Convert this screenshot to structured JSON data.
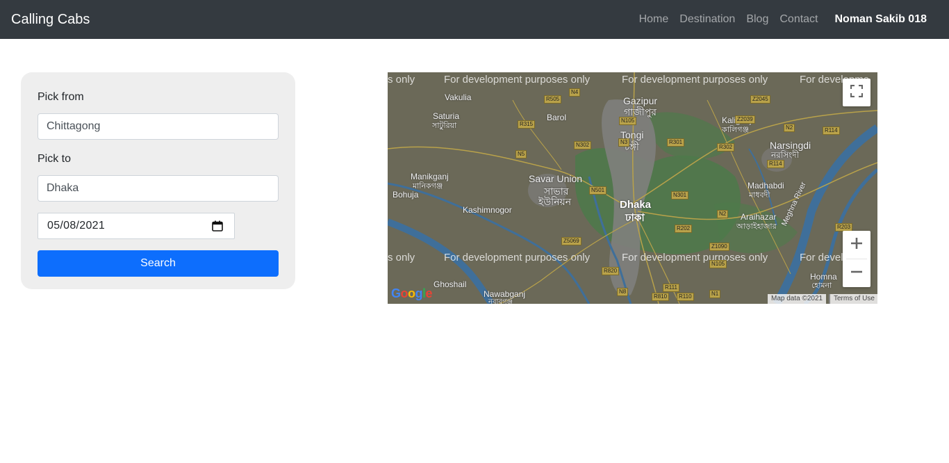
{
  "navbar": {
    "brand": "Calling Cabs",
    "links": [
      "Home",
      "Destination",
      "Blog",
      "Contact"
    ],
    "user": "Noman Sakib 018"
  },
  "form": {
    "pick_from_label": "Pick from",
    "pick_from_value": "Chittagong",
    "pick_to_label": "Pick to",
    "pick_to_value": "Dhaka",
    "date_value": "05/08/2021",
    "search_label": "Search"
  },
  "map": {
    "watermark": "For development purposes only",
    "watermark_partial_left": "s only",
    "watermark_partial_right": "For developme",
    "places": {
      "vakulia": "Vakulia",
      "saturia": "Saturia",
      "saturia_bn": "সাটুরিয়া",
      "barol": "Barol",
      "gazipur": "Gazipur",
      "gazipur_bn": "গাজীপুর",
      "kaliganj": "Kaliganj",
      "kaliganj_bn": "কালিগঞ্জ",
      "narsingdi": "Narsingdi",
      "narsingdi_bn": "নরসিংদী",
      "tongi": "Tongi",
      "tongi_bn": "টঙ্গী",
      "manikganj": "Manikganj",
      "manikganj_bn": "মানিকগঞ্জ",
      "savar": "Savar Union",
      "savar_bn1": "সাভার",
      "savar_bn2": "ইউনিয়ন",
      "bohuja": "Bohuja",
      "kashimnogor": "Kashimnogor",
      "dhaka": "Dhaka",
      "dhaka_bn": "ঢাকা",
      "madhabdi": "Madhabdi",
      "madhabdi_bn": "মাধবদী",
      "araihazar": "Araihazar",
      "araihazar_bn": "আড়াইহাজার",
      "meghna": "Meghna River",
      "ghoshail": "Ghoshail",
      "nawabganj": "Nawabganj",
      "nawabganj_bn": "নবাবগঞ্জ",
      "homna": "Homna",
      "homna_bn": "হোমনা"
    },
    "roads": {
      "n4": "N4",
      "r505": "R505",
      "r315": "R315",
      "n5": "N5",
      "n302": "N302",
      "n105a": "N105",
      "n3": "N3",
      "r301": "R301",
      "z2039": "Z2039",
      "r302": "R302",
      "z2045": "Z2045",
      "n2a": "N2",
      "r114a": "R114",
      "r114b": "R114",
      "n501": "N501",
      "n301": "N301",
      "n2b": "N2",
      "r202": "R202",
      "r203": "R203",
      "z5069": "Z5069",
      "z1090": "Z1090",
      "n105b": "N105",
      "r820": "R820",
      "r111": "R111",
      "n8": "N8",
      "r810": "R810",
      "r110": "R110",
      "n1": "N1"
    },
    "google_logo": "Google",
    "map_data": "Map data ©2021",
    "terms": "Terms of Use",
    "colors": {
      "base": "#6b6958",
      "green": "#4c7a4a",
      "urban": "#7f7e7c",
      "water": "#3f6f9a",
      "road": "#b9a24a"
    }
  },
  "colors": {
    "navbar_bg": "#343a40",
    "primary": "#0d6efd",
    "card_bg": "#eeeeee"
  }
}
